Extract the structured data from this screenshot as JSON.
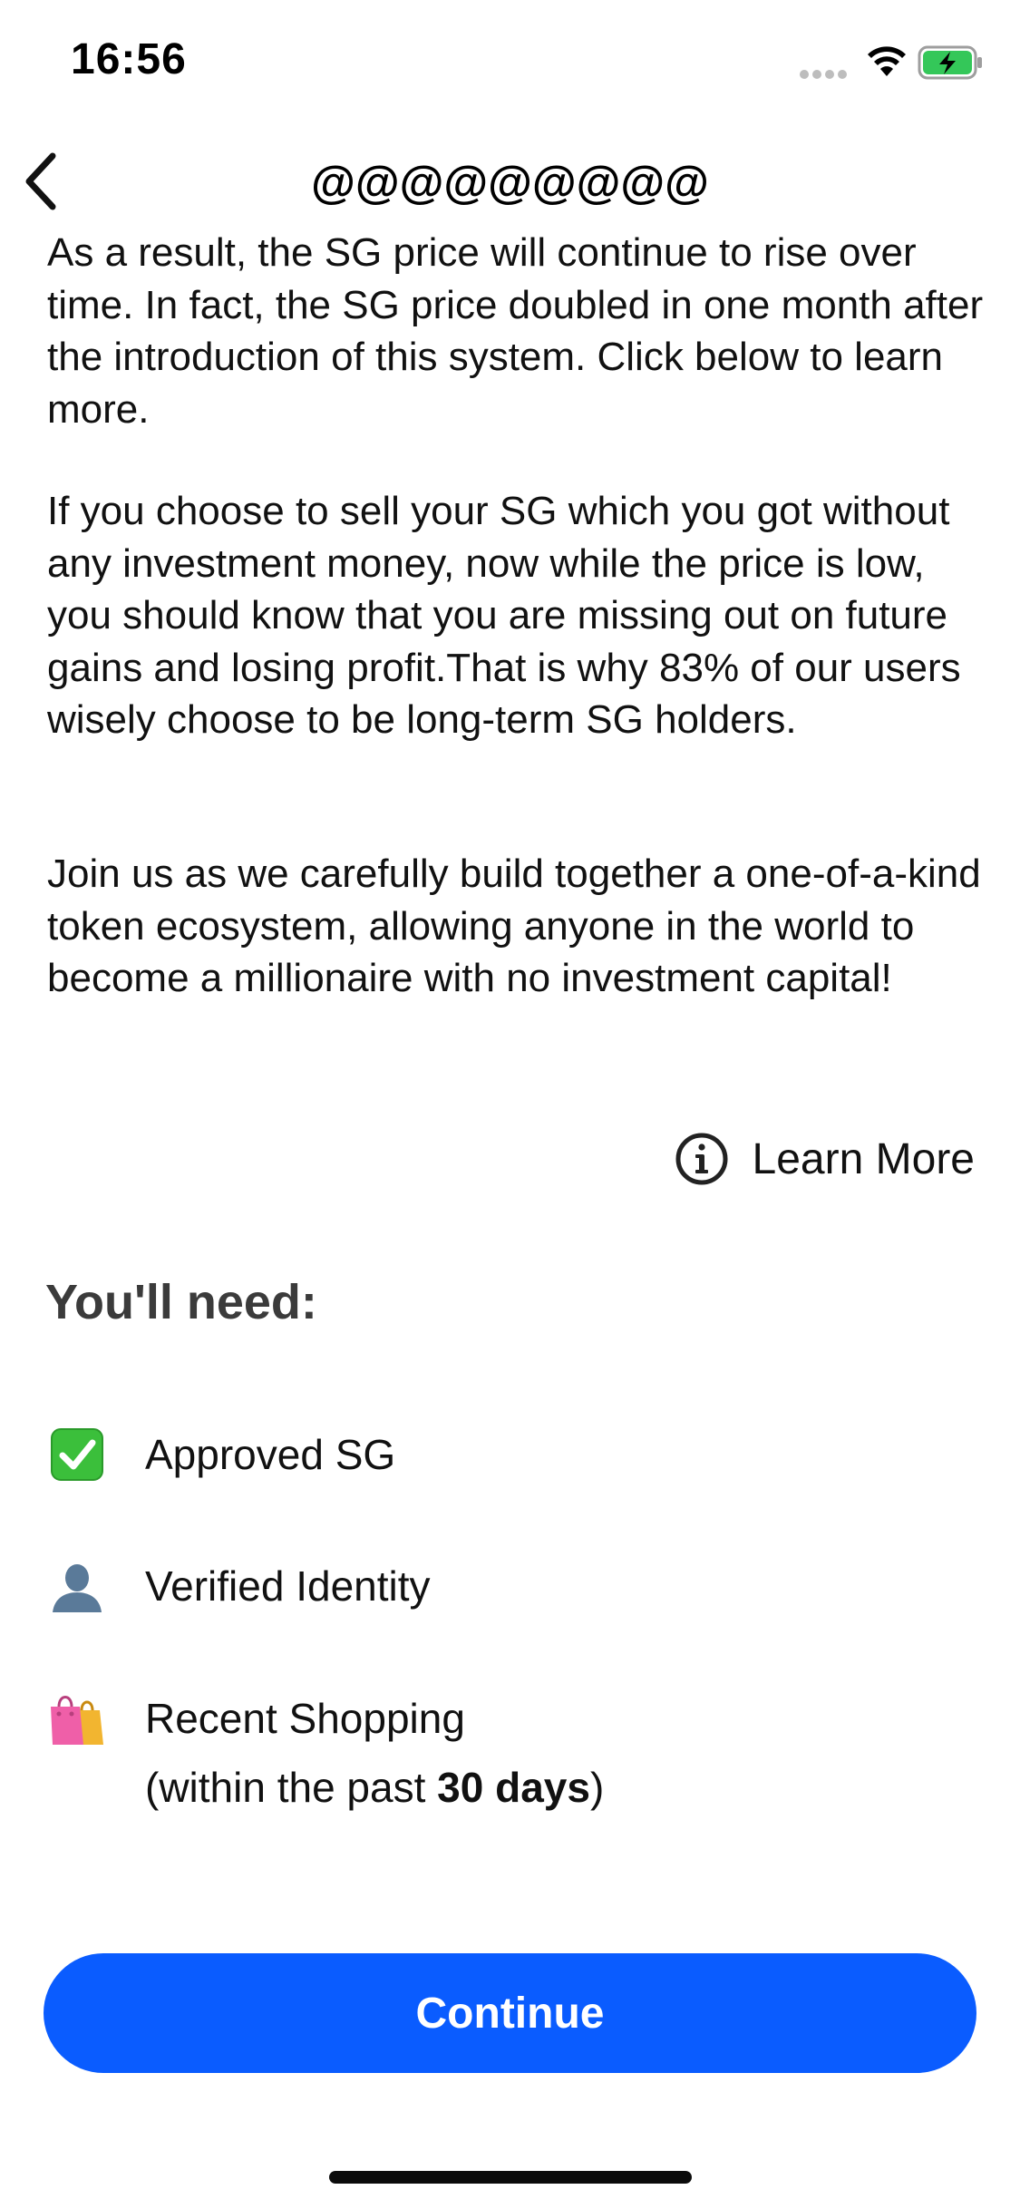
{
  "status_bar": {
    "time": "16:56",
    "icons": [
      "cellular-signal-icon",
      "wifi-icon",
      "battery-charging-icon"
    ],
    "battery_color": "#34c759"
  },
  "nav": {
    "title": "@@@@@@@@@",
    "back_icon": "chevron-left-icon"
  },
  "body": {
    "paragraphs": [
      "As a result, the SG price will continue to rise over time. In fact, the SG price doubled in one month after the introduction of this system. Click below to learn more.",
      "If you choose to sell your SG which you got without any investment money, now while the price is low, you should know that you are missing out on future gains and losing profit.That is why 83% of our users wisely choose to be long-term SG holders.",
      "Join us as we carefully build together a one-of-a-kind token ecosystem, allowing anyone in the world to become a millionaire with no investment capital!"
    ]
  },
  "learn_more": {
    "label": "Learn More",
    "icon": "info-circle-icon"
  },
  "needs": {
    "title": "You'll need:",
    "items": [
      {
        "icon": "check-mark-button-icon",
        "label": "Approved SG"
      },
      {
        "icon": "silhouette-person-icon",
        "label": "Verified Identity"
      },
      {
        "icon": "shopping-bags-icon",
        "label": "Recent Shopping",
        "sub_prefix": "(within the past ",
        "sub_bold": "30 days",
        "sub_suffix": ")"
      }
    ]
  },
  "continue_button": {
    "label": "Continue",
    "color": "#0a5cff"
  }
}
